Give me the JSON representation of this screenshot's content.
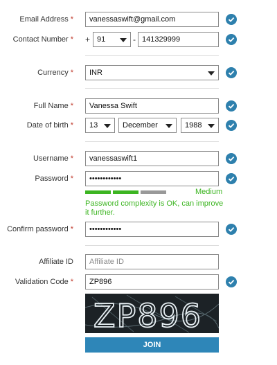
{
  "form": {
    "email": {
      "label": "Email Address",
      "value": "vanessaswift@gmail.com"
    },
    "contact": {
      "label": "Contact Number",
      "plus": "+",
      "country_code": "91",
      "dash": "-",
      "number": "141329999"
    },
    "currency": {
      "label": "Currency",
      "value": "INR"
    },
    "full_name": {
      "label": "Full Name",
      "value": "Vanessa Swift"
    },
    "dob": {
      "label": "Date of birth",
      "day": "13",
      "month": "December",
      "year": "1988"
    },
    "username": {
      "label": "Username",
      "value": "vanessaswift1"
    },
    "password": {
      "label": "Password",
      "value": "••••••••••••",
      "strength_label": "Medium",
      "strength_level": 0.67,
      "message": "Password complexity is OK, can improve it further."
    },
    "confirm_password": {
      "label": "Confirm password",
      "value": "••••••••••••"
    },
    "affiliate": {
      "label": "Affiliate ID",
      "placeholder": "Affiliate ID"
    },
    "validation": {
      "label": "Validation Code",
      "value": "ZP896"
    },
    "captcha_text": "ZP896",
    "required_marker": "*",
    "join_label": "JOIN"
  },
  "colors": {
    "check": "#2e80ad",
    "required": "#c0392b",
    "strength_good": "#3cb521",
    "strength_empty": "#999999",
    "join": "#2e86b8"
  }
}
